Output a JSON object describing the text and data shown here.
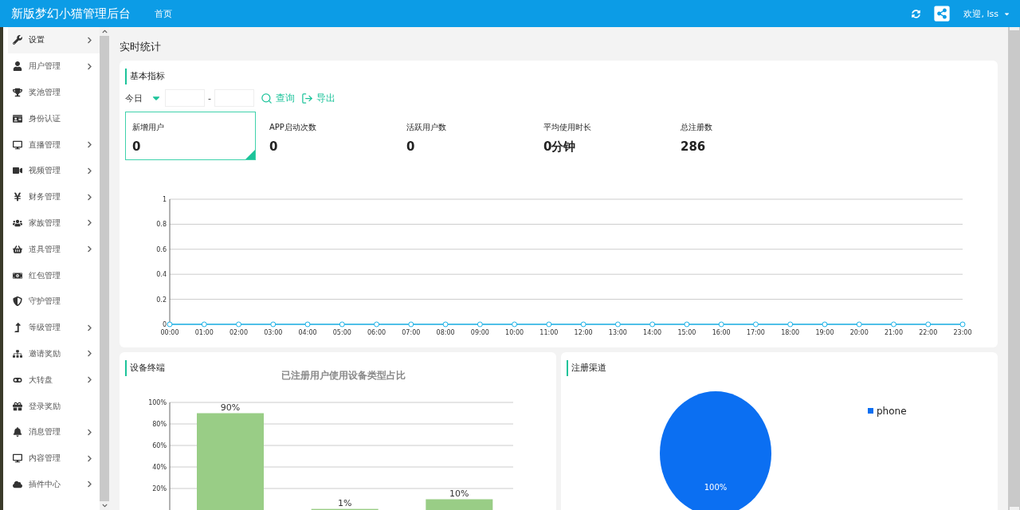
{
  "header": {
    "title": "新版梦幻小猫管理后台",
    "nav": [
      {
        "label": "首页"
      }
    ],
    "user": {
      "greeting": "欢迎, lss"
    }
  },
  "sidebar": {
    "items": [
      {
        "label": "设置",
        "expandable": true,
        "selected": true
      },
      {
        "label": "用户管理",
        "expandable": true,
        "selected": false
      },
      {
        "label": "奖池管理",
        "expandable": false,
        "selected": false
      },
      {
        "label": "身份认证",
        "expandable": false,
        "selected": false
      },
      {
        "label": "直播管理",
        "expandable": true,
        "selected": false
      },
      {
        "label": "视频管理",
        "expandable": true,
        "selected": false
      },
      {
        "label": "财务管理",
        "expandable": true,
        "selected": false
      },
      {
        "label": "家族管理",
        "expandable": true,
        "selected": false
      },
      {
        "label": "道具管理",
        "expandable": true,
        "selected": false
      },
      {
        "label": "红包管理",
        "expandable": false,
        "selected": false
      },
      {
        "label": "守护管理",
        "expandable": false,
        "selected": false
      },
      {
        "label": "等级管理",
        "expandable": true,
        "selected": false
      },
      {
        "label": "邀请奖励",
        "expandable": true,
        "selected": false
      },
      {
        "label": "大转盘",
        "expandable": true,
        "selected": false
      },
      {
        "label": "登录奖励",
        "expandable": false,
        "selected": false
      },
      {
        "label": "消息管理",
        "expandable": true,
        "selected": false
      },
      {
        "label": "内容管理",
        "expandable": true,
        "selected": false
      },
      {
        "label": "插件中心",
        "expandable": true,
        "selected": false
      }
    ]
  },
  "page_title": "实时统计",
  "basic": {
    "title": "基本指标",
    "range": {
      "value": "今日"
    },
    "separator": "-",
    "query": "查询",
    "export": "导出",
    "metrics": [
      {
        "label": "新增用户",
        "value": "0",
        "selected": true
      },
      {
        "label": "APP启动次数",
        "value": "0",
        "selected": false
      },
      {
        "label": "活跃用户数",
        "value": "0",
        "selected": false
      },
      {
        "label": "平均使用时长",
        "value": "0分钟",
        "selected": false
      },
      {
        "label": "总注册数",
        "value": "286",
        "selected": false
      }
    ],
    "chart_data": {
      "type": "line",
      "grid": true,
      "categories": [
        "00:00",
        "01:00",
        "02:00",
        "03:00",
        "04:00",
        "05:00",
        "06:00",
        "07:00",
        "08:00",
        "09:00",
        "10:00",
        "11:00",
        "12:00",
        "13:00",
        "14:00",
        "15:00",
        "16:00",
        "17:00",
        "18:00",
        "19:00",
        "20:00",
        "21:00",
        "22:00",
        "23:00"
      ],
      "series": [
        {
          "color": "#1cb3e8",
          "marker": true,
          "values": [
            0,
            0,
            0,
            0,
            0,
            0,
            0,
            0,
            0,
            0,
            0,
            0,
            0,
            0,
            0,
            0,
            0,
            0,
            0,
            0,
            0,
            0,
            0,
            0
          ]
        }
      ],
      "ylim": [
        0,
        1
      ],
      "yticks": [
        0,
        0.2,
        0.4,
        0.6,
        0.8,
        1
      ]
    }
  },
  "devices": {
    "title": "设备终端",
    "chart_data": {
      "type": "bar",
      "grid": true,
      "title": "已注册用户使用设备类型占比",
      "series": [
        {
          "color": "#99cd86",
          "values": [
            90,
            1,
            10
          ]
        }
      ],
      "ylim": [
        0,
        100
      ],
      "yticks": [
        {
          "value": 20,
          "label": "20%"
        },
        {
          "value": 40,
          "label": "40%"
        },
        {
          "value": 60,
          "label": "60%"
        },
        {
          "value": 80,
          "label": "80%"
        },
        {
          "value": 100,
          "label": "100%"
        }
      ],
      "value_labels": [
        "90%",
        "1%",
        "10%"
      ]
    }
  },
  "channels": {
    "title": "注册渠道",
    "chart_data": {
      "type": "pie",
      "categories": [
        "phone"
      ],
      "series": [
        {
          "color": "#0b6ff2",
          "values": [
            100
          ]
        }
      ],
      "value_labels": [
        "100%"
      ]
    }
  }
}
